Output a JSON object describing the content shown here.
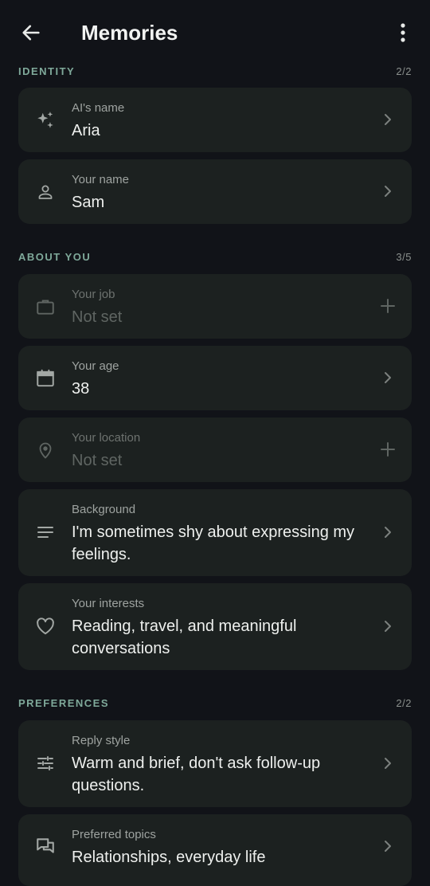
{
  "header": {
    "title": "Memories"
  },
  "sections": [
    {
      "label": "IDENTITY",
      "count": "2/2",
      "items": [
        {
          "label": "AI's name",
          "value": "Aria",
          "icon": "sparkle-icon",
          "state": "set"
        },
        {
          "label": "Your name",
          "value": "Sam",
          "icon": "person-icon",
          "state": "set"
        }
      ]
    },
    {
      "label": "ABOUT YOU",
      "count": "3/5",
      "items": [
        {
          "label": "Your job",
          "value": "Not set",
          "icon": "briefcase-icon",
          "state": "empty"
        },
        {
          "label": "Your age",
          "value": "38",
          "icon": "calendar-icon",
          "state": "set"
        },
        {
          "label": "Your location",
          "value": "Not set",
          "icon": "location-pin-icon",
          "state": "empty"
        },
        {
          "label": "Background",
          "value": "I'm sometimes shy about expressing my feelings.",
          "icon": "lines-icon",
          "state": "set"
        },
        {
          "label": "Your interests",
          "value": "Reading, travel, and meaningful conversations",
          "icon": "heart-icon",
          "state": "set"
        }
      ]
    },
    {
      "label": "PREFERENCES",
      "count": "2/2",
      "items": [
        {
          "label": "Reply style",
          "value": "Warm and brief, don't ask follow-up questions.",
          "icon": "sliders-icon",
          "state": "set"
        },
        {
          "label": "Preferred topics",
          "value": "Relationships, everyday life",
          "icon": "chat-icon",
          "state": "set"
        }
      ]
    }
  ],
  "colors": {
    "background": "#111318",
    "card": "#1c2120",
    "section_label": "#7fa99a"
  }
}
